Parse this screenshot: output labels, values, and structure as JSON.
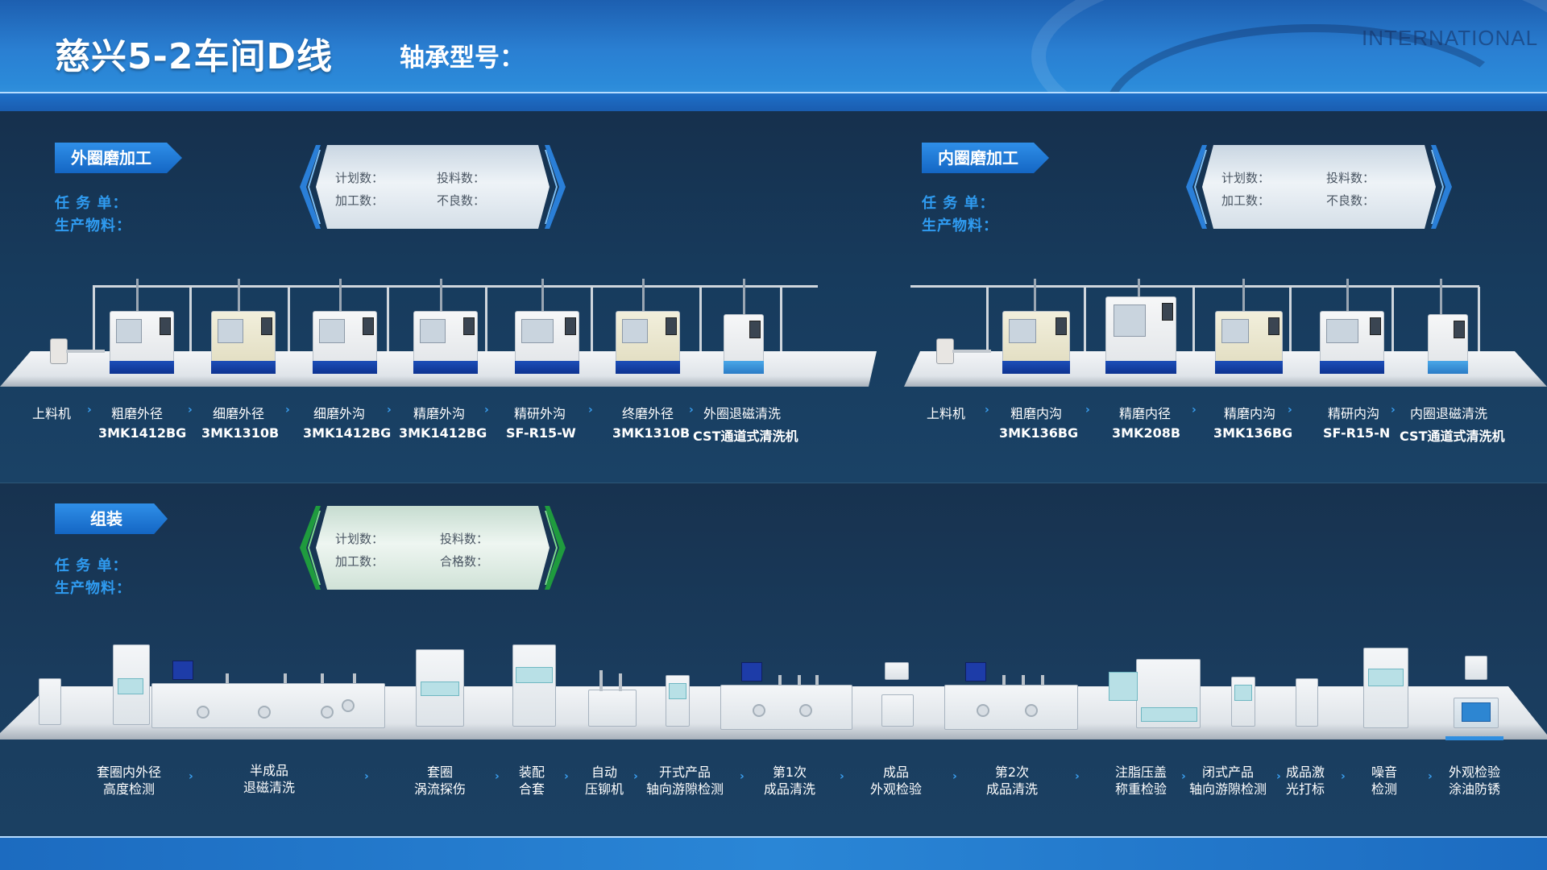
{
  "header": {
    "title": "慈兴5-2车间D线",
    "subtitle": "轴承型号：",
    "watermark": "INTERNATIONAL"
  },
  "colors": {
    "accent": "#2f9bf0",
    "badge": "#1466c4",
    "background": "#153250",
    "machine_base": "#0d3290"
  },
  "outer_ring": {
    "badge": "外圈磨加工",
    "task_label": "任 务 单：",
    "material_label": "生产物料：",
    "stats": {
      "planned": "计划数：",
      "fed": "投料数：",
      "processed": "加工数：",
      "defective": "不良数："
    },
    "stations": [
      {
        "name": "上料机",
        "model": ""
      },
      {
        "name": "粗磨外径",
        "model": "3MK1412BG"
      },
      {
        "name": "细磨外径",
        "model": "3MK1310B"
      },
      {
        "name": "细磨外沟",
        "model": "3MK1412BG"
      },
      {
        "name": "精磨外沟",
        "model": "3MK1412BG"
      },
      {
        "name": "精研外沟",
        "model": "SF-R15-W"
      },
      {
        "name": "终磨外径",
        "model": "3MK1310B"
      },
      {
        "name": "外圈退磁清洗",
        "model": "CST通道式清洗机"
      }
    ]
  },
  "inner_ring": {
    "badge": "内圈磨加工",
    "task_label": "任 务 单：",
    "material_label": "生产物料：",
    "stats": {
      "planned": "计划数：",
      "fed": "投料数：",
      "processed": "加工数：",
      "defective": "不良数："
    },
    "stations": [
      {
        "name": "上料机",
        "model": ""
      },
      {
        "name": "粗磨内沟",
        "model": "3MK136BG"
      },
      {
        "name": "精磨内径",
        "model": "3MK208B"
      },
      {
        "name": "精磨内沟",
        "model": "3MK136BG"
      },
      {
        "name": "精研内沟",
        "model": "SF-R15-N"
      },
      {
        "name": "内圈退磁清洗",
        "model": "CST通道式清洗机"
      }
    ]
  },
  "assembly": {
    "badge": "组装",
    "task_label": "任 务 单：",
    "material_label": "生产物料：",
    "stats": {
      "planned": "计划数：",
      "fed": "投料数：",
      "processed": "加工数：",
      "qualified": "合格数："
    },
    "stations": [
      {
        "line1": "套圈内外径",
        "line2": "高度检测"
      },
      {
        "line1": "半成品",
        "line2": "退磁清洗"
      },
      {
        "line1": "套圈",
        "line2": "涡流探伤"
      },
      {
        "line1": "装配",
        "line2": "合套"
      },
      {
        "line1": "自动",
        "line2": "压铆机"
      },
      {
        "line1": "开式产品",
        "line2": "轴向游隙检测"
      },
      {
        "line1": "第1次",
        "line2": "成品清洗"
      },
      {
        "line1": "成品",
        "line2": "外观检验"
      },
      {
        "line1": "第2次",
        "line2": "成品清洗"
      },
      {
        "line1": "注脂压盖",
        "line2": "称重检验"
      },
      {
        "line1": "闭式产品",
        "line2": "轴向游隙检测"
      },
      {
        "line1": "成品激",
        "line2": "光打标"
      },
      {
        "line1": "噪音",
        "line2": "检测"
      },
      {
        "line1": "外观检验",
        "line2": "涂油防锈"
      }
    ]
  },
  "icons": {
    "separator": "chevron-right-icon"
  }
}
